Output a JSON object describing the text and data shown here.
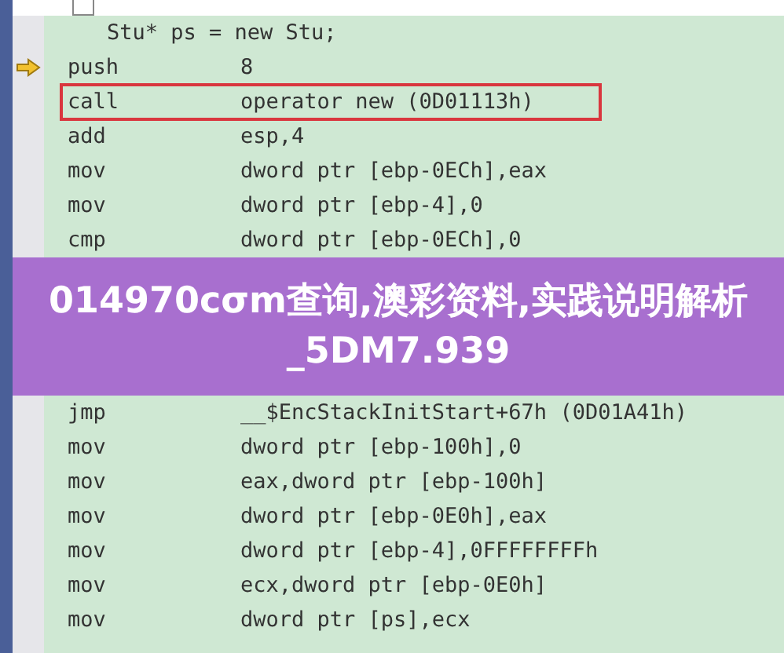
{
  "source_line": "Stu* ps = new Stu;",
  "rows_before": [
    {
      "mnemonic": "push",
      "operand": "8",
      "current": true,
      "highlighted": false
    },
    {
      "mnemonic": "call",
      "operand": "operator new (0D01113h)",
      "current": false,
      "highlighted": true
    },
    {
      "mnemonic": "add",
      "operand": "esp,4",
      "current": false,
      "highlighted": false
    },
    {
      "mnemonic": "mov",
      "operand": "dword ptr [ebp-0ECh],eax",
      "current": false,
      "highlighted": false
    },
    {
      "mnemonic": "mov",
      "operand": "dword ptr [ebp-4],0",
      "current": false,
      "highlighted": false
    },
    {
      "mnemonic": "cmp",
      "operand": "dword ptr [ebp-0ECh],0",
      "current": false,
      "highlighted": false
    }
  ],
  "banner": {
    "title": "014970cσm查询,澳彩资料,实践说明解析_5DM7.939"
  },
  "rows_after": [
    {
      "mnemonic": "jmp",
      "operand": "__$EncStackInitStart+67h (0D01A41h)",
      "current": false,
      "highlighted": false
    },
    {
      "mnemonic": "mov",
      "operand": "dword ptr [ebp-100h],0",
      "current": false,
      "highlighted": false
    },
    {
      "mnemonic": "mov",
      "operand": "eax,dword ptr [ebp-100h]",
      "current": false,
      "highlighted": false
    },
    {
      "mnemonic": "mov",
      "operand": "dword ptr [ebp-0E0h],eax",
      "current": false,
      "highlighted": false
    },
    {
      "mnemonic": "mov",
      "operand": "dword ptr [ebp-4],0FFFFFFFFh",
      "current": false,
      "highlighted": false
    },
    {
      "mnemonic": "mov",
      "operand": "ecx,dword ptr [ebp-0E0h]",
      "current": false,
      "highlighted": false
    },
    {
      "mnemonic": "mov",
      "operand": "dword ptr [ps],ecx",
      "current": false,
      "highlighted": false
    }
  ]
}
